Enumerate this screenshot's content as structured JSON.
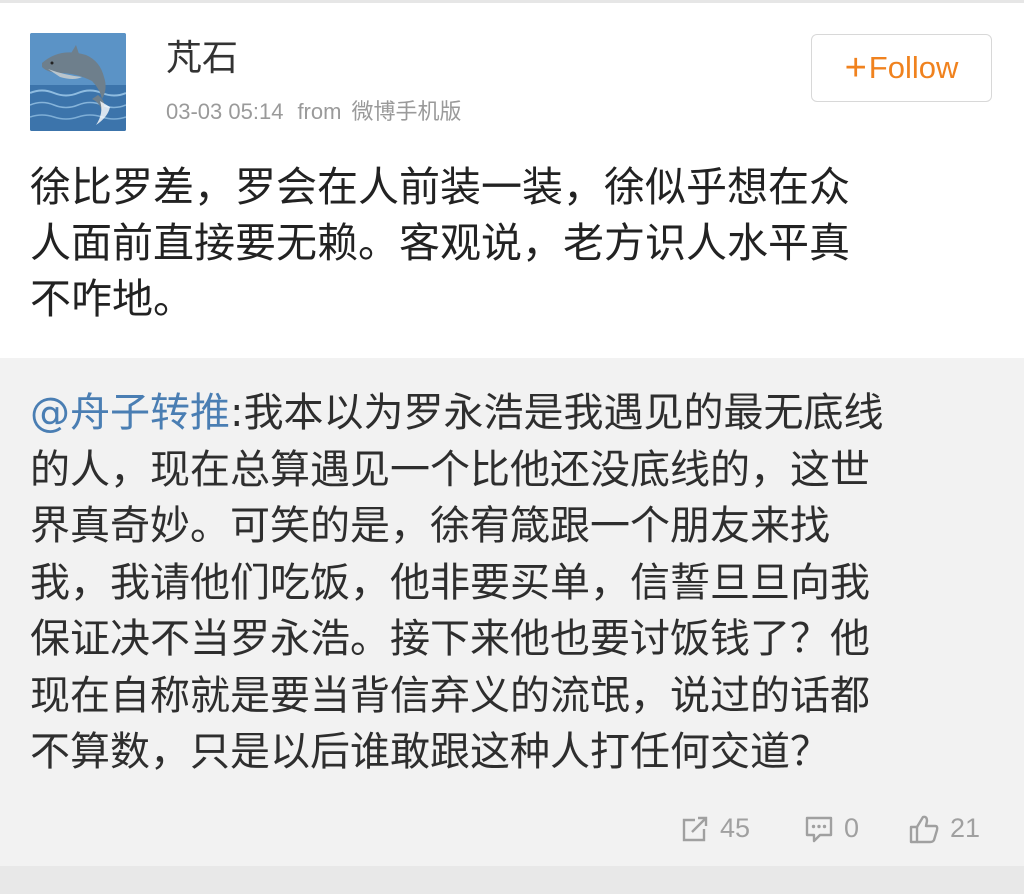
{
  "post": {
    "username": "芃石",
    "timestamp": "03-03 05:14",
    "from_label": "from",
    "source": "微博手机版",
    "follow_label": "Follow",
    "text_lines": [
      "徐比罗差，罗会在人前装一装，徐似乎想在众",
      "人面前直接要无赖。客观说，老方识人水平真",
      "不咋地。"
    ]
  },
  "repost": {
    "mention": "@舟子转推",
    "text_lines": [
      ":我本以为罗永浩是我遇见的最无底线",
      "的人，现在总算遇见一个比他还没底线的，这世",
      "界真奇妙。可笑的是，徐宥箴跟一个朋友来找",
      "我，我请他们吃饭，他非要买单，信誓旦旦向我",
      "保证决不当罗永浩。接下来他也要讨饭钱了？他",
      "现在自称就是要当背信弃义的流氓，说过的话都",
      "不算数，只是以后谁敢跟这种人打任何交道？"
    ],
    "actions": {
      "repost_count": "45",
      "comment_count": "0",
      "like_count": "21"
    }
  },
  "colors": {
    "accent": "#f0821e",
    "link": "#4a7eb3",
    "muted": "#9a9a9a"
  },
  "icons": [
    "dolphin-avatar",
    "plus-icon",
    "share-icon",
    "comment-icon",
    "thumbs-up-icon"
  ]
}
